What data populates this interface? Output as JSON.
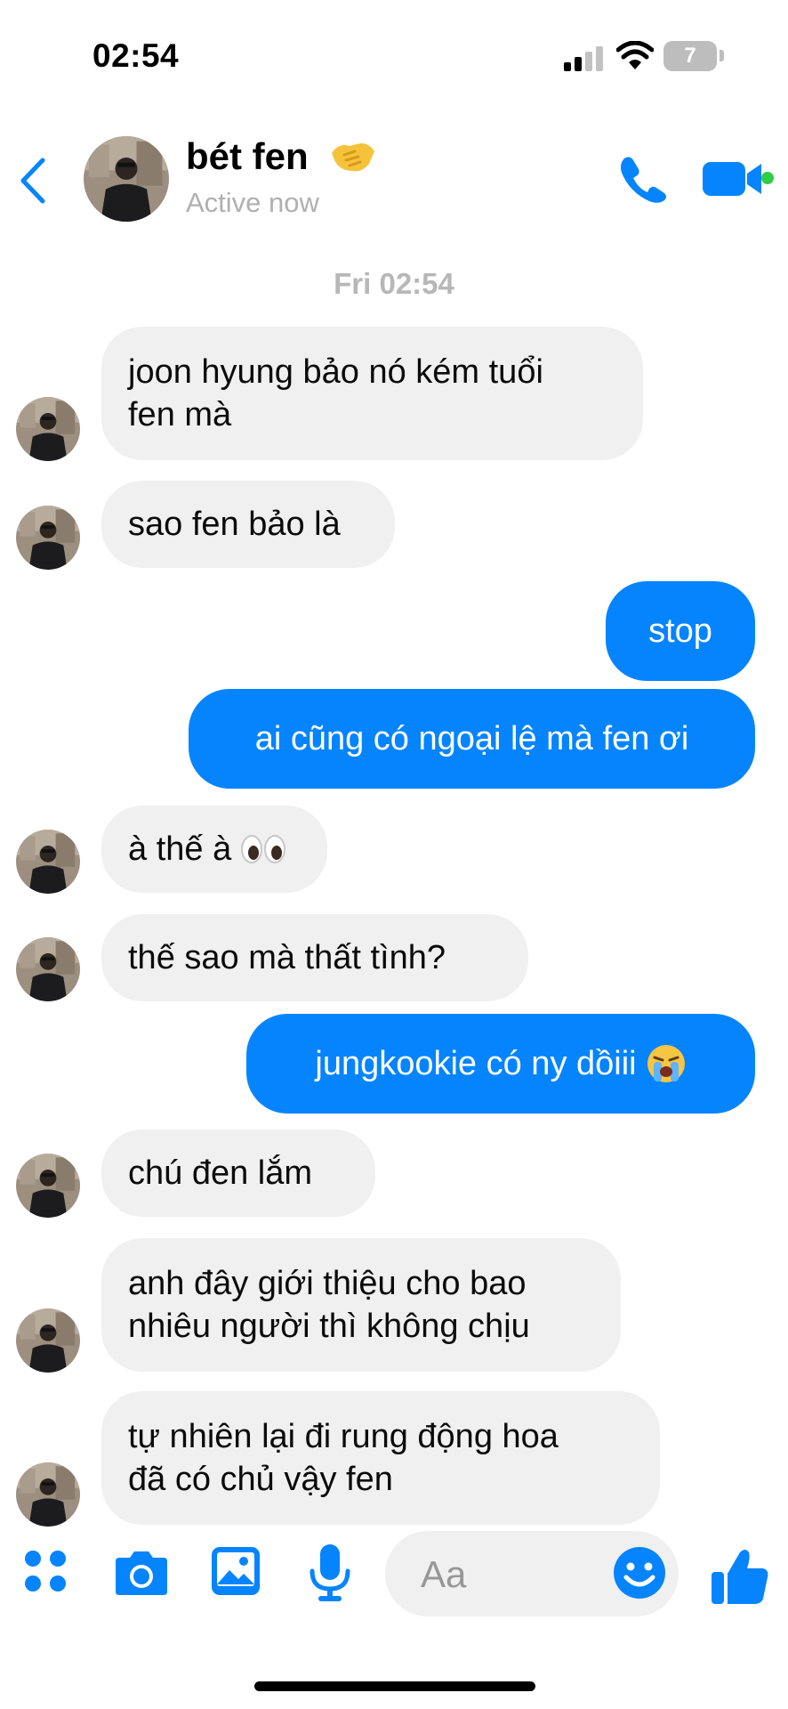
{
  "status_bar": {
    "time": "02:54",
    "battery_level": "7"
  },
  "header": {
    "contact_name": "bét fen",
    "contact_status": "Active now",
    "back_icon": "chevron-left-icon",
    "call_icon": "phone-icon",
    "video_icon": "video-camera-icon",
    "handshake_emoji": "handshake-emoji"
  },
  "chat": {
    "timestamp": "Fri 02:54",
    "messages": [
      {
        "from": "them",
        "text": "joon hyung bảo nó kém tuổi",
        "text2": "fen mà"
      },
      {
        "from": "them",
        "text": "sao fen bảo là"
      },
      {
        "from": "me",
        "text": "stop"
      },
      {
        "from": "me",
        "text": "ai cũng có ngoại lệ mà fen ơi"
      },
      {
        "from": "them",
        "text": "à thế à",
        "emoji": "eyes-emoji"
      },
      {
        "from": "them",
        "text": "thế sao mà thất tình?"
      },
      {
        "from": "me",
        "text": "jungkookie có ny dồiii",
        "emoji": "crying-face-emoji"
      },
      {
        "from": "them",
        "text": "chú đen lắm"
      },
      {
        "from": "them",
        "text": "anh đây giới thiệu cho bao",
        "text2": "nhiêu người thì không chịu"
      },
      {
        "from": "them",
        "text": "tự nhiên lại đi rung động hoa",
        "text2": "đã có chủ vậy fen"
      }
    ]
  },
  "composer": {
    "placeholder": "Aa",
    "icons": [
      "apps-grid-icon",
      "camera-icon",
      "photo-icon",
      "microphone-icon",
      "emoji-icon",
      "thumbs-up-icon"
    ]
  },
  "colors": {
    "accent": "#0584fe",
    "incoming_bubble": "#f0f0f0",
    "online": "#31cc46",
    "muted_text": "#b0b0b0"
  }
}
